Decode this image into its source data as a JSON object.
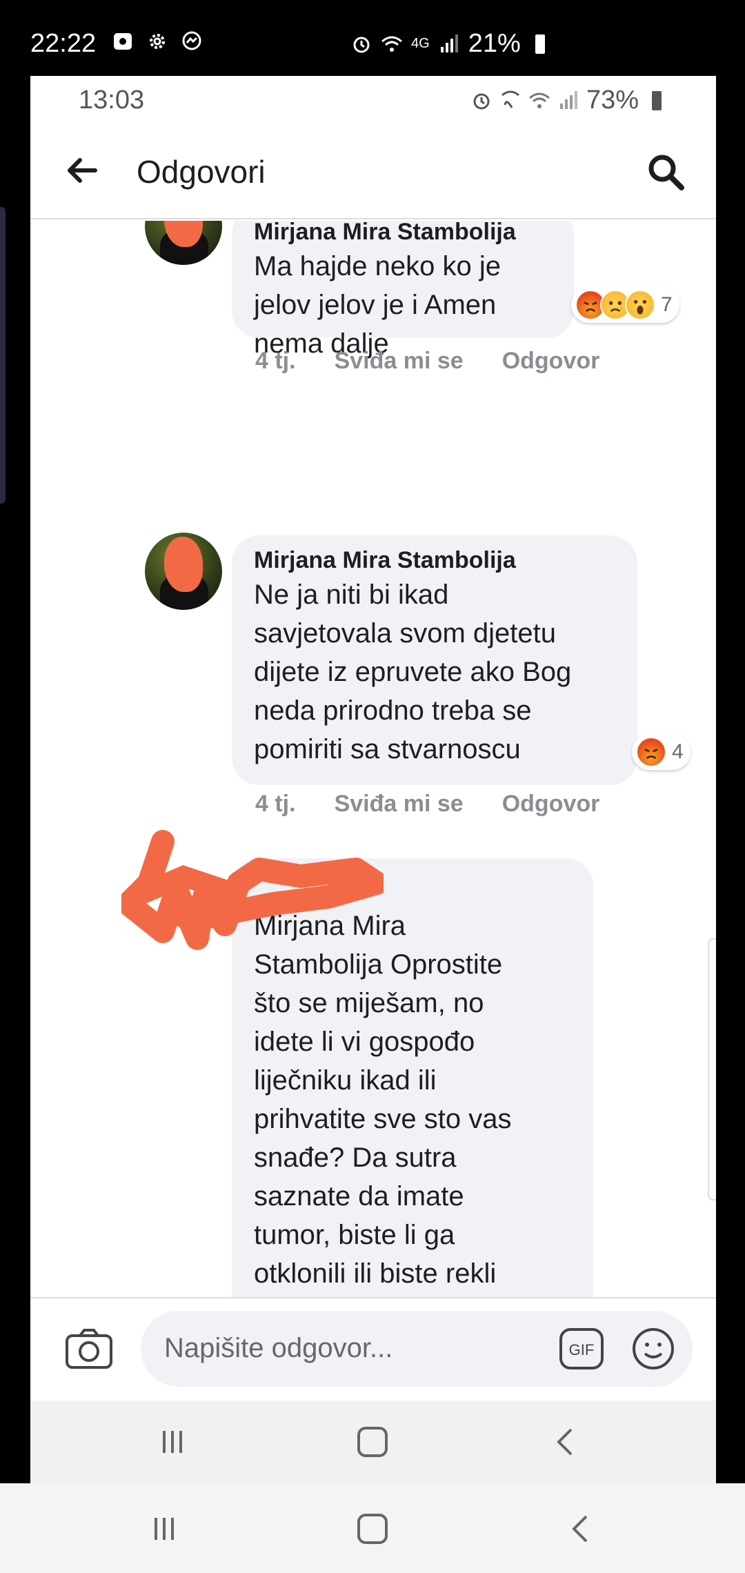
{
  "outer_status": {
    "time": "22:22",
    "network": "4G",
    "battery": "21%"
  },
  "inner_status": {
    "time": "13:03",
    "battery": "73%"
  },
  "header": {
    "title": "Odgovori"
  },
  "comments": [
    {
      "author": "Mirjana Mira Stambolija",
      "text": "Ma hajde neko ko je\njelov jelov je i Amen\nnema dalje",
      "time": "4 tj.",
      "like": "Sviđa mi se",
      "reply": "Odgovor",
      "reactions": [
        "angry",
        "sad",
        "wow"
      ],
      "reaction_count": "7"
    },
    {
      "author": "Mirjana Mira Stambolija",
      "text": "Ne  ja  niti bi ikad\nsavjetovala svom djetetu\ndijete iz epruvete ako Bog\nneda prirodno treba se\npomiriti sa stvarnoscu",
      "time": "4 tj.",
      "like": "Sviđa mi se",
      "reply": "Odgovor",
      "reactions": [
        "angry"
      ],
      "reaction_count": "4"
    },
    {
      "author": "",
      "text": "Mirjana Mira\nStambolija Oprostite\nšto se miješam, no\nidete li vi gospođo\nliječniku ikad ili\nprihvatite sve sto vas\nsnađe? Da sutra\nsaznate da imate\ntumor, biste li ga\notklonili ili biste rekli\n\"neka ga, od Boga je\"? I\nako se već pozivate na"
    }
  ],
  "composer": {
    "placeholder": "Napišite odgovor...",
    "gif_label": "GIF"
  },
  "colors": {
    "bubble": "#f0f2f5",
    "redaction": "#f26a45",
    "meta": "#8a8d91"
  }
}
